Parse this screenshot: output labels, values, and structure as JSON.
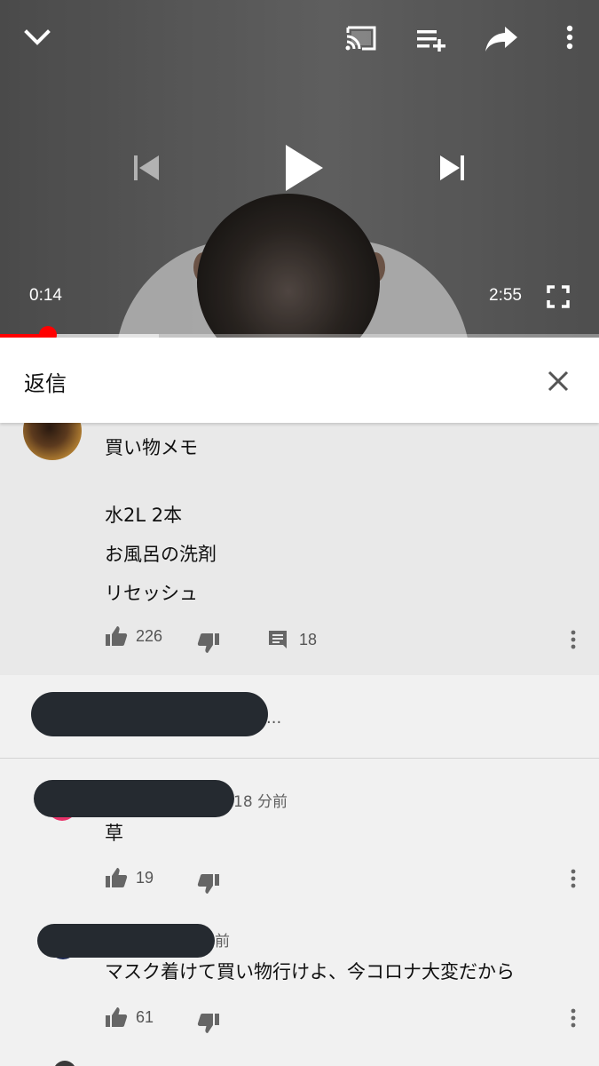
{
  "player": {
    "current_time": "0:14",
    "duration": "2:55",
    "played_fraction": 0.08,
    "buffered_fraction": 0.265,
    "progress_color": "#ff0000",
    "icons": [
      "chevron-down-icon",
      "cast-icon",
      "add-to-playlist-icon",
      "share-icon",
      "more-vert-icon",
      "skip-previous-icon",
      "play-icon",
      "skip-next-icon",
      "fullscreen-icon"
    ]
  },
  "reply_panel": {
    "title": "返信",
    "close_icon": "close-icon"
  },
  "parent_comment": {
    "lines": [
      "買い物メモ",
      "",
      "水2L 2本",
      "お風呂の洗剤",
      "リセッシュ"
    ],
    "likes": "226",
    "replies": "18"
  },
  "more_replies_text": "...",
  "replies": [
    {
      "timestamp": "18 分前",
      "text": "草",
      "likes": "19"
    },
    {
      "timestamp": "前",
      "text": "マスク着けて買い物行けよ、今コロナ大変だから",
      "likes": "61"
    }
  ]
}
